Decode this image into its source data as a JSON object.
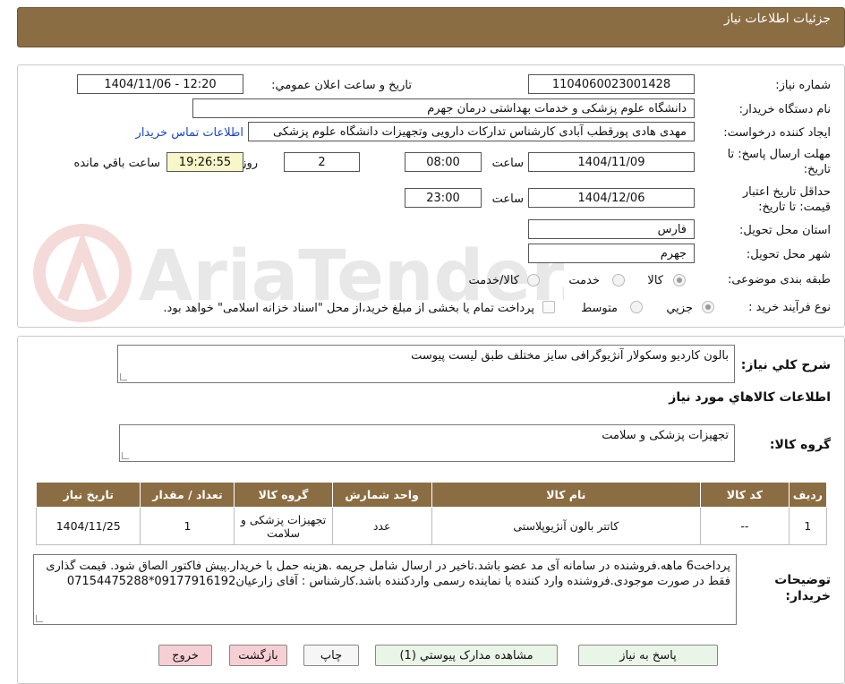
{
  "header": {
    "title": "جزئیات اطلاعات نیاز"
  },
  "watermark": {
    "text": "AriaTender.net"
  },
  "form": {
    "need_number_label": "شماره نیاز:",
    "need_number": "1104060023001428",
    "announce_label": "تاریخ و ساعت اعلان عمومي:",
    "announce_value": "1404/11/06 - 12:20",
    "buyer_label": "نام دستگاه خريدار:",
    "buyer_value": "دانشگاه علوم پزشکی و خدمات بهداشتی  درمان جهرم",
    "requester_label": "ایجاد کننده درخواست:",
    "requester_value": "مهدی هادی پورقطب آبادی کارشناس تدارکات دارویی وتجهیزات دانشگاه علوم پزشکی",
    "contact_link": "اطلاعات تماس خریدار",
    "deadline_label_1": "مهلت ارسال پاسخ: تا",
    "deadline_label_2": "تاریخ:",
    "deadline_date": "1404/11/09",
    "time_label": "ساعت",
    "deadline_time": "08:00",
    "days_value": "2",
    "days_label": "روز و",
    "remaining_time": "19:26:55",
    "remaining_label": "ساعت باقي مانده",
    "validity_label_1": "حداقل تاريخ اعتبار",
    "validity_label_2": "قیمت: تا تاریخ:",
    "validity_date": "1404/12/06",
    "validity_time_label": "ساعت",
    "validity_time": "23:00",
    "province_label": "استان محل تحویل:",
    "province_value": "فارس",
    "city_label": "شهر محل تحویل:",
    "city_value": "جهرم",
    "category_label": "طبقه بندی موضوعی:",
    "category_options": [
      "کالا",
      "خدمت",
      "کالا/خدمت"
    ],
    "category_selected": "کالا",
    "process_label": "نوع فرآیند خرید :",
    "process_options": [
      "جزیي",
      "متوسط"
    ],
    "process_selected": "جزیي",
    "payment_note": "پرداخت تمام یا بخشی از مبلغ خرید،از محل \"اسناد خزانه اسلامی\" خواهد بود."
  },
  "summary": {
    "label": "شرح کلي نياز:",
    "value": "بالون کاردیو وسکولار آنژیوگرافی سایز مختلف طبق لیست پیوست",
    "goods_section_title": "اطلاعات کالاهاي مورد نياز",
    "group_label": "گروه کالا:",
    "group_value": "تجهیزات پزشکی و سلامت"
  },
  "table": {
    "headers": [
      "رديف",
      "کد کالا",
      "نام کالا",
      "واحد شمارش",
      "گروه کالا",
      "تعداد / مقدار",
      "تاریخ نیاز"
    ],
    "rows": [
      [
        "1",
        "--",
        "کاتتر بالون آنژیوپلاستی",
        "عدد",
        "تجهیزات پزشکی و سلامت",
        "1",
        "1404/11/25"
      ]
    ]
  },
  "notes": {
    "label_1": "توضیحات",
    "label_2": "خریدار:",
    "value": "پرداخت6 ماهه.فروشنده در سامانه آی مد عضو باشد.تاخیر در ارسال شامل جریمه .هزینه حمل با خریدار.پیش فاکتور الصاق شود. قیمت گذاری فقط در صورت موجودی.فروشنده وارد کننده یا نماینده رسمی واردکننده باشد.کارشناس : آقای زارعیان09177916192*07154475288"
  },
  "buttons": {
    "reply": "پاسخ به نياز",
    "attachments": "مشاهده مدارک پيوستي (1)",
    "print": "چاپ",
    "back": "بازگشت",
    "exit": "خروج"
  },
  "colors": {
    "header": "#8b6d43",
    "link": "#1a44c8",
    "highlight": "#f7f7c9",
    "exit_button": "#f6cfd4",
    "reply_button": "#e9f5e6"
  }
}
